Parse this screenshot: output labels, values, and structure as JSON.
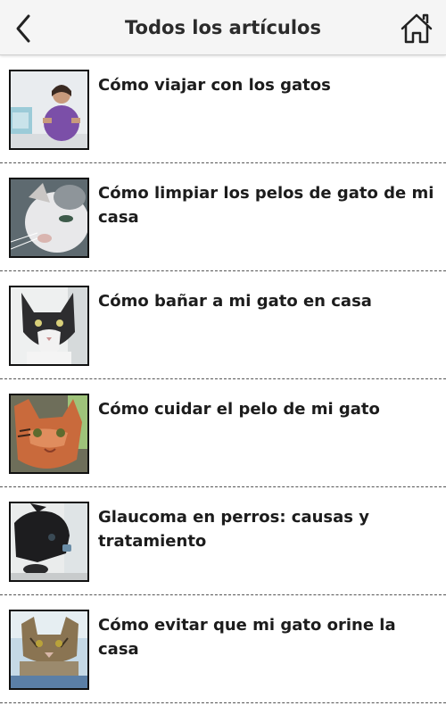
{
  "header": {
    "title": "Todos los artículos",
    "back_icon": "chevron-left-icon",
    "home_icon": "home-icon"
  },
  "articles": [
    {
      "title": "Cómo viajar con los gatos"
    },
    {
      "title": "Cómo limpiar los pelos de gato de mi casa"
    },
    {
      "title": "Cómo bañar a mi gato en casa"
    },
    {
      "title": "Cómo cuidar el pelo de mi gato"
    },
    {
      "title": "Glaucoma en perros: causas y tratamiento"
    },
    {
      "title": "Cómo evitar que mi gato orine la casa"
    }
  ]
}
